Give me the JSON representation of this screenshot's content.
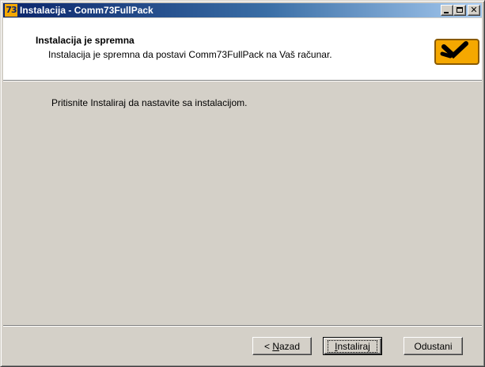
{
  "window": {
    "title": "Instalacija - Comm73FullPack",
    "icon": "app-73-icon",
    "icon_text": "73",
    "controls": {
      "minimize": "minimize-icon",
      "maximize": "maximize-icon",
      "close": "close-icon",
      "close_glyph": "✕"
    }
  },
  "header": {
    "title": "Instalacija je spremna",
    "subtitle": "Instalacija je spremna da postavi Comm73FullPack na Vaš računar.",
    "icon": "installer-wizard-icon"
  },
  "body": {
    "text": "Pritisnite Instaliraj da nastavite sa instalacijom."
  },
  "buttons": {
    "back_prefix": "< ",
    "back_mnemonic": "N",
    "back_rest": "azad",
    "install_mnemonic": "I",
    "install_rest": "nstaliraj",
    "cancel": "Odustani"
  },
  "colors": {
    "titlebar_start": "#0a246a",
    "titlebar_end": "#a6caf0",
    "face": "#d4d0c8",
    "accent_icon": "#f5a800"
  }
}
